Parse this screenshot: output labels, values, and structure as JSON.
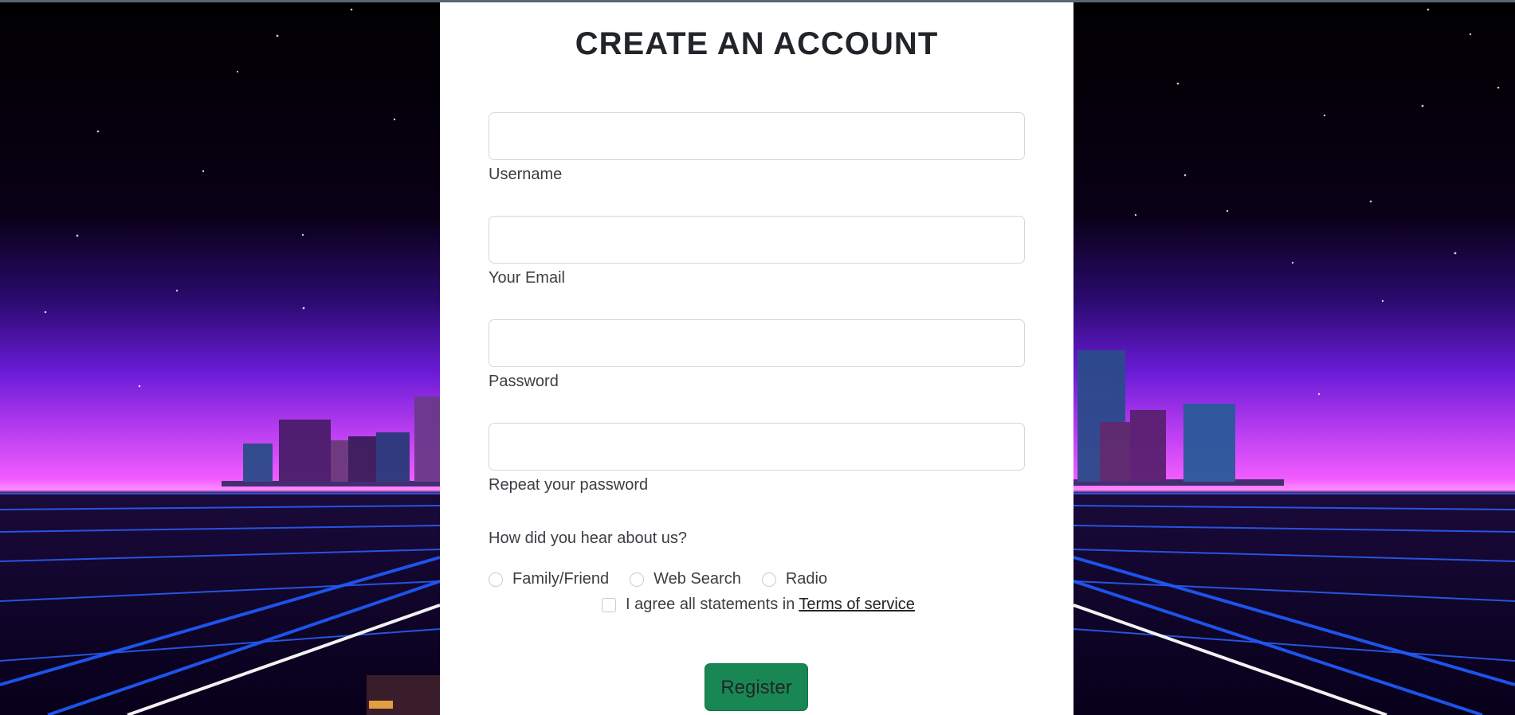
{
  "form": {
    "title": "CREATE AN ACCOUNT",
    "fields": [
      {
        "label": "Username",
        "value": "",
        "placeholder": ""
      },
      {
        "label": "Your Email",
        "value": "",
        "placeholder": ""
      },
      {
        "label": "Password",
        "value": "",
        "placeholder": ""
      },
      {
        "label": "Repeat your password",
        "value": "",
        "placeholder": ""
      }
    ],
    "question": "How did you hear about us?",
    "options": [
      "Family/Friend",
      "Web Search",
      "Radio"
    ],
    "agree_text": "I agree all statements in",
    "tos_link": "Terms of service",
    "submit_label": "Register"
  },
  "colors": {
    "card_bg": "#ffffff",
    "text": "#212529",
    "button": "#198754",
    "background_sky_top": "#000000",
    "background_horizon": "#e040fb",
    "grid_lines": "#2962ff"
  },
  "background": {
    "description_icon": "synthwave-city-icon"
  }
}
